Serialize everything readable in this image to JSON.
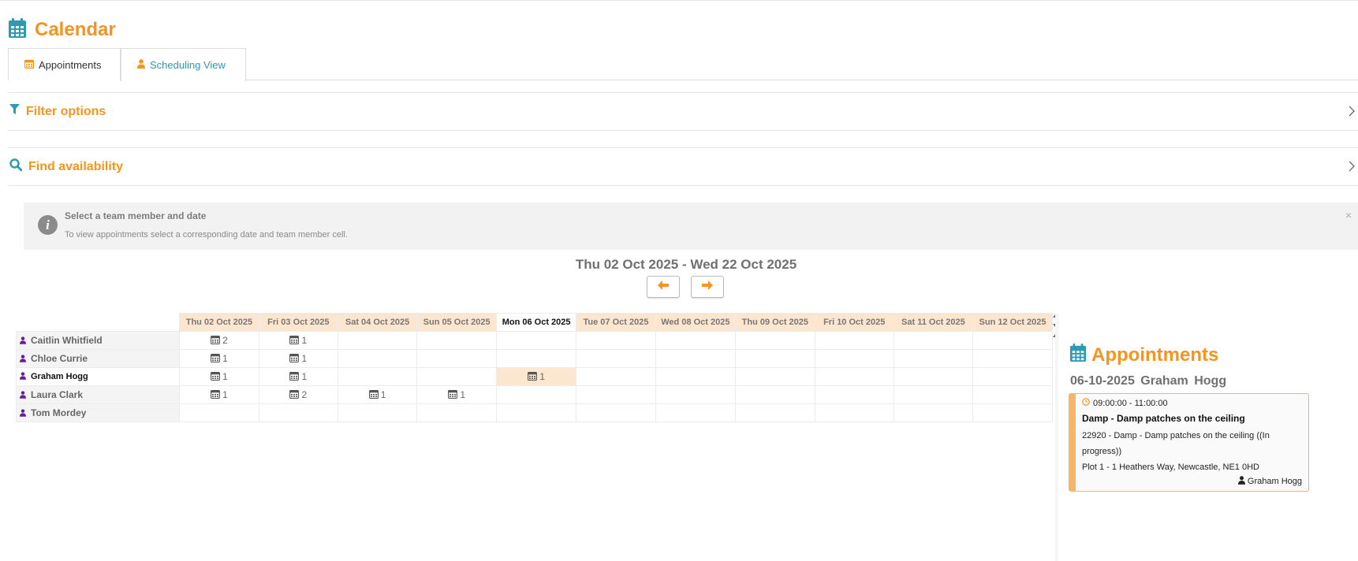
{
  "page": {
    "title": "Calendar"
  },
  "tabs": [
    {
      "label": "Appointments",
      "icon": "calendar-icon"
    },
    {
      "label": "Scheduling View",
      "icon": "person-icon",
      "active": true
    }
  ],
  "panels": {
    "filter": {
      "label": "Filter options"
    },
    "find": {
      "label": "Find availability"
    }
  },
  "alert": {
    "title": "Select a team member and date",
    "text": "To view appointments select a corresponding date and team member cell.",
    "close": "×"
  },
  "range": {
    "label": "Thu 02 Oct 2025 - Wed 22 Oct 2025"
  },
  "grid": {
    "days": [
      "Thu 02 Oct 2025",
      "Fri 03 Oct 2025",
      "Sat 04 Oct 2025",
      "Sun 05 Oct 2025",
      "Mon 06 Oct 2025",
      "Tue 07 Oct 2025",
      "Wed 08 Oct 2025",
      "Thu 09 Oct 2025",
      "Fri 10 Oct 2025",
      "Sat 11 Oct 2025",
      "Sun 12 Oct 2025"
    ],
    "today_index": 4,
    "rows": [
      {
        "name": "Caitlin Whitfield",
        "counts": [
          "2",
          "1",
          "",
          "",
          "",
          "",
          "",
          "",
          "",
          "",
          ""
        ]
      },
      {
        "name": "Chloe Currie",
        "counts": [
          "1",
          "1",
          "",
          "",
          "",
          "",
          "",
          "",
          "",
          "",
          ""
        ]
      },
      {
        "name": "Graham Hogg",
        "selected": true,
        "counts": [
          "1",
          "1",
          "",
          "",
          "1",
          "",
          "",
          "",
          "",
          "",
          ""
        ]
      },
      {
        "name": "Laura Clark",
        "counts": [
          "1",
          "2",
          "1",
          "1",
          "",
          "",
          "",
          "",
          "",
          "",
          ""
        ]
      },
      {
        "name": "Tom Mordey",
        "counts": [
          "",
          "",
          "",
          "",
          "",
          "",
          "",
          "",
          "",
          "",
          ""
        ]
      }
    ],
    "active_cell": {
      "row": 2,
      "col": 4
    }
  },
  "appointments": {
    "title": "Appointments",
    "date": "06-10-2025",
    "person": "Graham Hogg",
    "card": {
      "time": "09:00:00 - 11:00:00",
      "subject": "Damp - Damp patches on the ceiling",
      "description": "22920 - Damp - Damp patches on the ceiling ((In progress))",
      "address": "Plot 1 - 1 Heathers Way, Newcastle, NE1 0HD",
      "owner": "Graham Hogg"
    }
  },
  "colors": {
    "accent": "#f7941d",
    "teal": "#2a9bb3",
    "header_bg": "#fde6cf",
    "person_icon": "#6a1b9a"
  }
}
